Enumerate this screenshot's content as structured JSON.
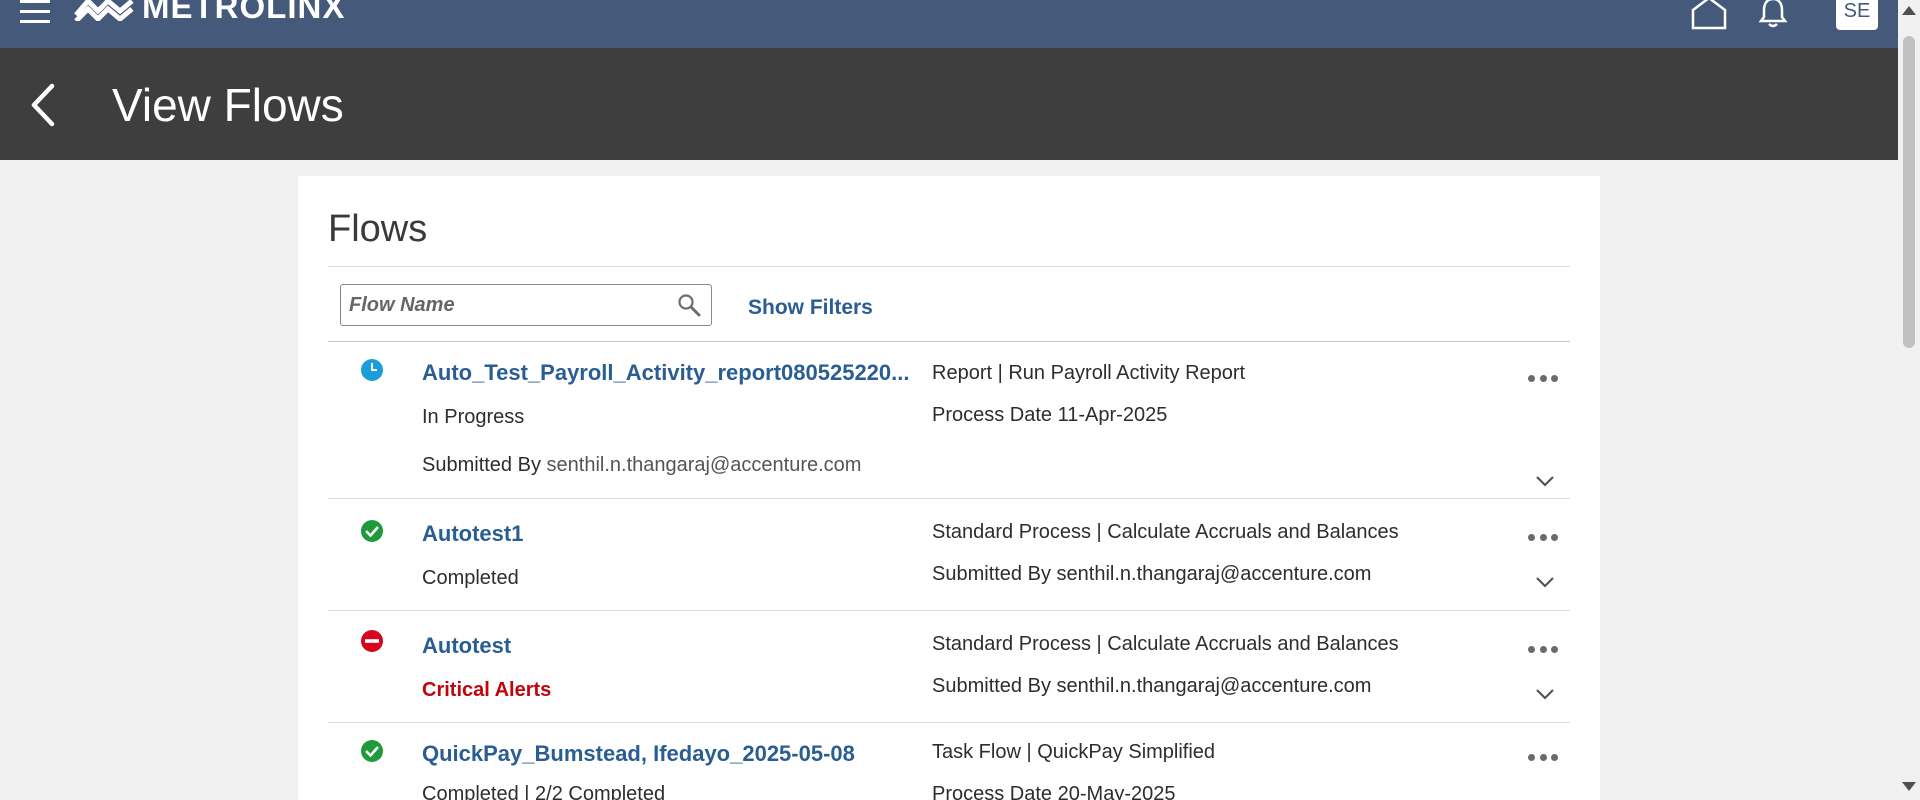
{
  "brand": {
    "name": "METROLINX"
  },
  "header": {
    "avatar_initials": "SE"
  },
  "page": {
    "title": "View Flows"
  },
  "panel": {
    "title": "Flows",
    "search": {
      "placeholder": "Flow Name",
      "value": ""
    },
    "show_filters_label": "Show Filters"
  },
  "flows": [
    {
      "name": "Auto_Test_Payroll_Activity_report080525220...",
      "status": "In Progress",
      "status_icon": "clock-icon",
      "status_color": "#1a9ed9",
      "submitted_by_label": "Submitted By",
      "submitted_by": "senthil.n.thangaraj@accenture.com",
      "type": "Report | Run Payroll Activity Report",
      "process_date_label": "Process Date",
      "process_date": "11-Apr-2025"
    },
    {
      "name": "Autotest1",
      "status": "Completed",
      "status_icon": "check-circle-icon",
      "status_color": "#1f9a3a",
      "type": "Standard Process | Calculate Accruals and Balances",
      "submitted_by_label": "Submitted By",
      "submitted_by": "senthil.n.thangaraj@accenture.com"
    },
    {
      "name": "Autotest",
      "status": "Critical Alerts",
      "status_icon": "error-circle-icon",
      "status_color": "#d6051e",
      "type": "Standard Process | Calculate Accruals and Balances",
      "submitted_by_label": "Submitted By",
      "submitted_by": "senthil.n.thangaraj@accenture.com"
    },
    {
      "name": "QuickPay_Bumstead, Ifedayo_2025-05-08",
      "status": "Completed | 2/2 Completed",
      "status_icon": "check-circle-icon",
      "status_color": "#1f9a3a",
      "type": "Task Flow | QuickPay Simplified",
      "process_date_label": "Process Date",
      "process_date": "20-May-2025"
    }
  ],
  "colors": {
    "topbar": "#455a7a",
    "page_header": "#3e3e3e",
    "link": "#2a5d92",
    "critical": "#c1050e"
  }
}
